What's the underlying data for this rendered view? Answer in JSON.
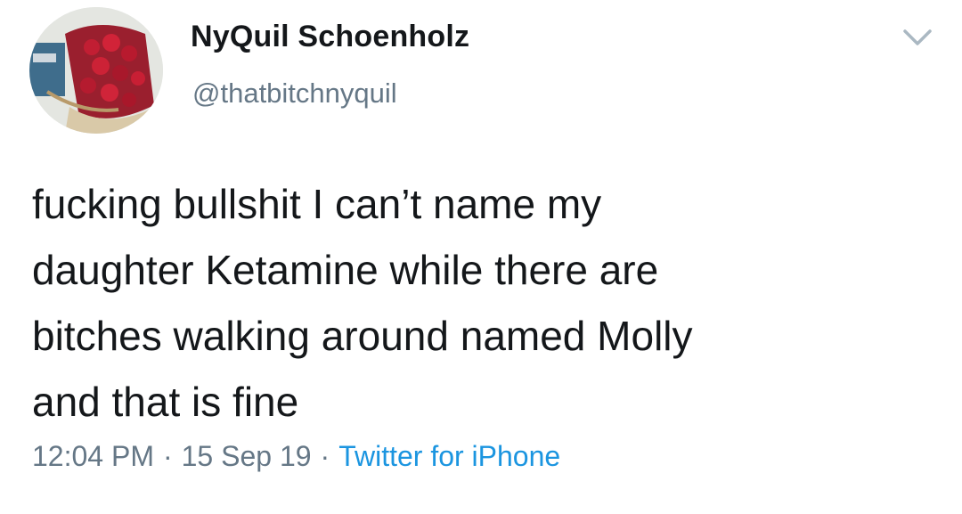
{
  "user": {
    "display_name": "NyQuil Schoenholz",
    "handle": "@thatbitchnyquil",
    "avatar_icon": "avatar-photo-icon"
  },
  "tweet": {
    "text": "fucking bullshit I can’t name my\ndaughter Ketamine while there are\nbitches walking around named Molly\nand that is fine",
    "time": "12:04 PM",
    "separator": "·",
    "date": "15 Sep 19",
    "client": "Twitter for iPhone"
  },
  "icons": {
    "menu": "chevron-down-icon"
  },
  "colors": {
    "text": "#14171a",
    "secondary": "#657786",
    "link": "#1b95e0",
    "caret": "#aab8c2"
  }
}
